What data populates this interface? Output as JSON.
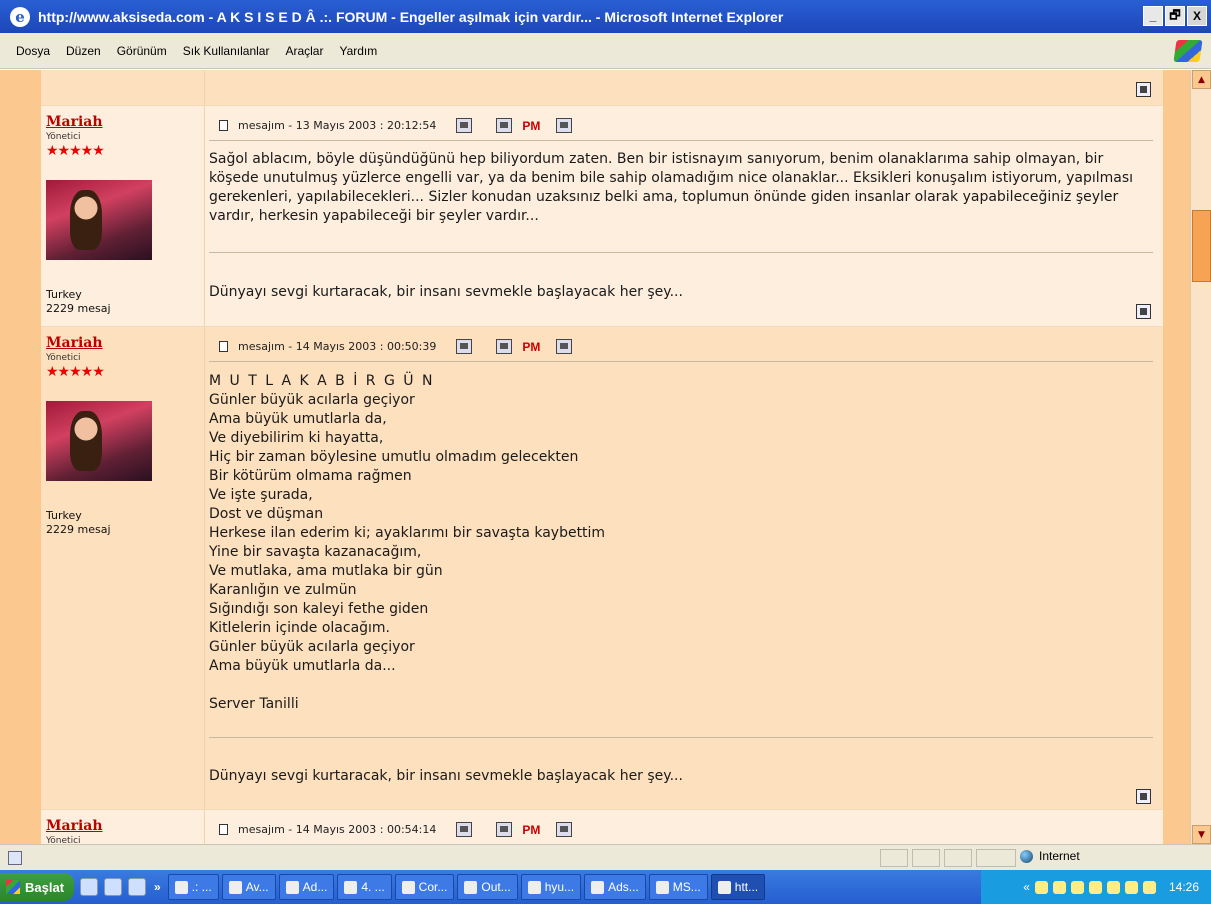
{
  "window": {
    "title": "http://www.aksiseda.com - A K S I S E D Â .:. FORUM - Engeller aşılmak için vardır... - Microsoft Internet Explorer",
    "buttons": [
      "_",
      "🗗",
      "X"
    ]
  },
  "menu": [
    "Dosya",
    "Düzen",
    "Görünüm",
    "Sık Kullanılanlar",
    "Araçlar",
    "Yardım"
  ],
  "posts": [
    {
      "user": "Mariah",
      "role": "Yönetici",
      "stars": "★★★★★",
      "location": "Turkey",
      "count": "2229 mesaj",
      "meta": "mesajım - 13 Mayıs 2003 :  20:12:54",
      "pm": "PM",
      "body": "Sağol ablacım, böyle düşündüğünü hep biliyordum zaten. Ben bir istisnayım sanıyorum, benim olanaklarıma sahip olmayan, bir köşede unutulmuş yüzlerce engelli var, ya da benim bile sahip olamadığım nice olanaklar... Eksikleri konuşalım istiyorum, yapılması gerekenleri, yapılabilecekleri... Sizler konudan uzaksınız belki ama, toplumun önünde giden insanlar olarak yapabileceğiniz şeyler vardır, herkesin yapabileceği bir şeyler vardır...",
      "signature": "Dünyayı sevgi kurtaracak, bir insanı sevmekle başlayacak her şey..."
    },
    {
      "user": "Mariah",
      "role": "Yönetici",
      "stars": "★★★★★",
      "location": "Turkey",
      "count": "2229 mesaj",
      "meta": "mesajım - 14 Mayıs 2003 :  00:50:39",
      "pm": "PM",
      "poem_title": "M U T L A K A B İ R G Ü N",
      "poem_lines": [
        "Günler büyük acılarla geçiyor",
        "Ama büyük umutlarla da,",
        "Ve diyebilirim ki hayatta,",
        "Hiç bir zaman böylesine umutlu olmadım gelecekten",
        "Bir kötürüm olmama rağmen",
        "Ve işte şurada,",
        "Dost ve düşman",
        "Herkese ilan ederim ki; ayaklarımı bir savaşta kaybettim",
        "Yine bir savaşta kazanacağım,",
        "Ve mutlaka, ama mutlaka bir gün",
        "Karanlığın ve zulmün",
        "Sığındığı son kaleyi fethe giden",
        "Kitlelerin içinde olacağım.",
        "Günler büyük acılarla geçiyor",
        "Ama büyük umutlarla da..."
      ],
      "author": "Server Tanilli",
      "signature": "Dünyayı sevgi kurtaracak, bir insanı sevmekle başlayacak her şey..."
    },
    {
      "user": "Mariah",
      "role": "Yönetici",
      "meta": "mesajım - 14 Mayıs 2003 :  00:54:14",
      "pm": "PM"
    }
  ],
  "status": {
    "zone": "Internet"
  },
  "taskbar": {
    "start": "Başlat",
    "quick_more": "»",
    "items": [
      ".: ...",
      "Av...",
      "Ad...",
      "4. ...",
      "Cor...",
      "Out...",
      "hyu...",
      "Ads...",
      "MS...",
      "htt..."
    ],
    "tray_more": "«",
    "clock": "14:26"
  },
  "colors": {
    "accent": "#fbc88f",
    "username": "#bb0000",
    "pm": "#cc0000"
  }
}
